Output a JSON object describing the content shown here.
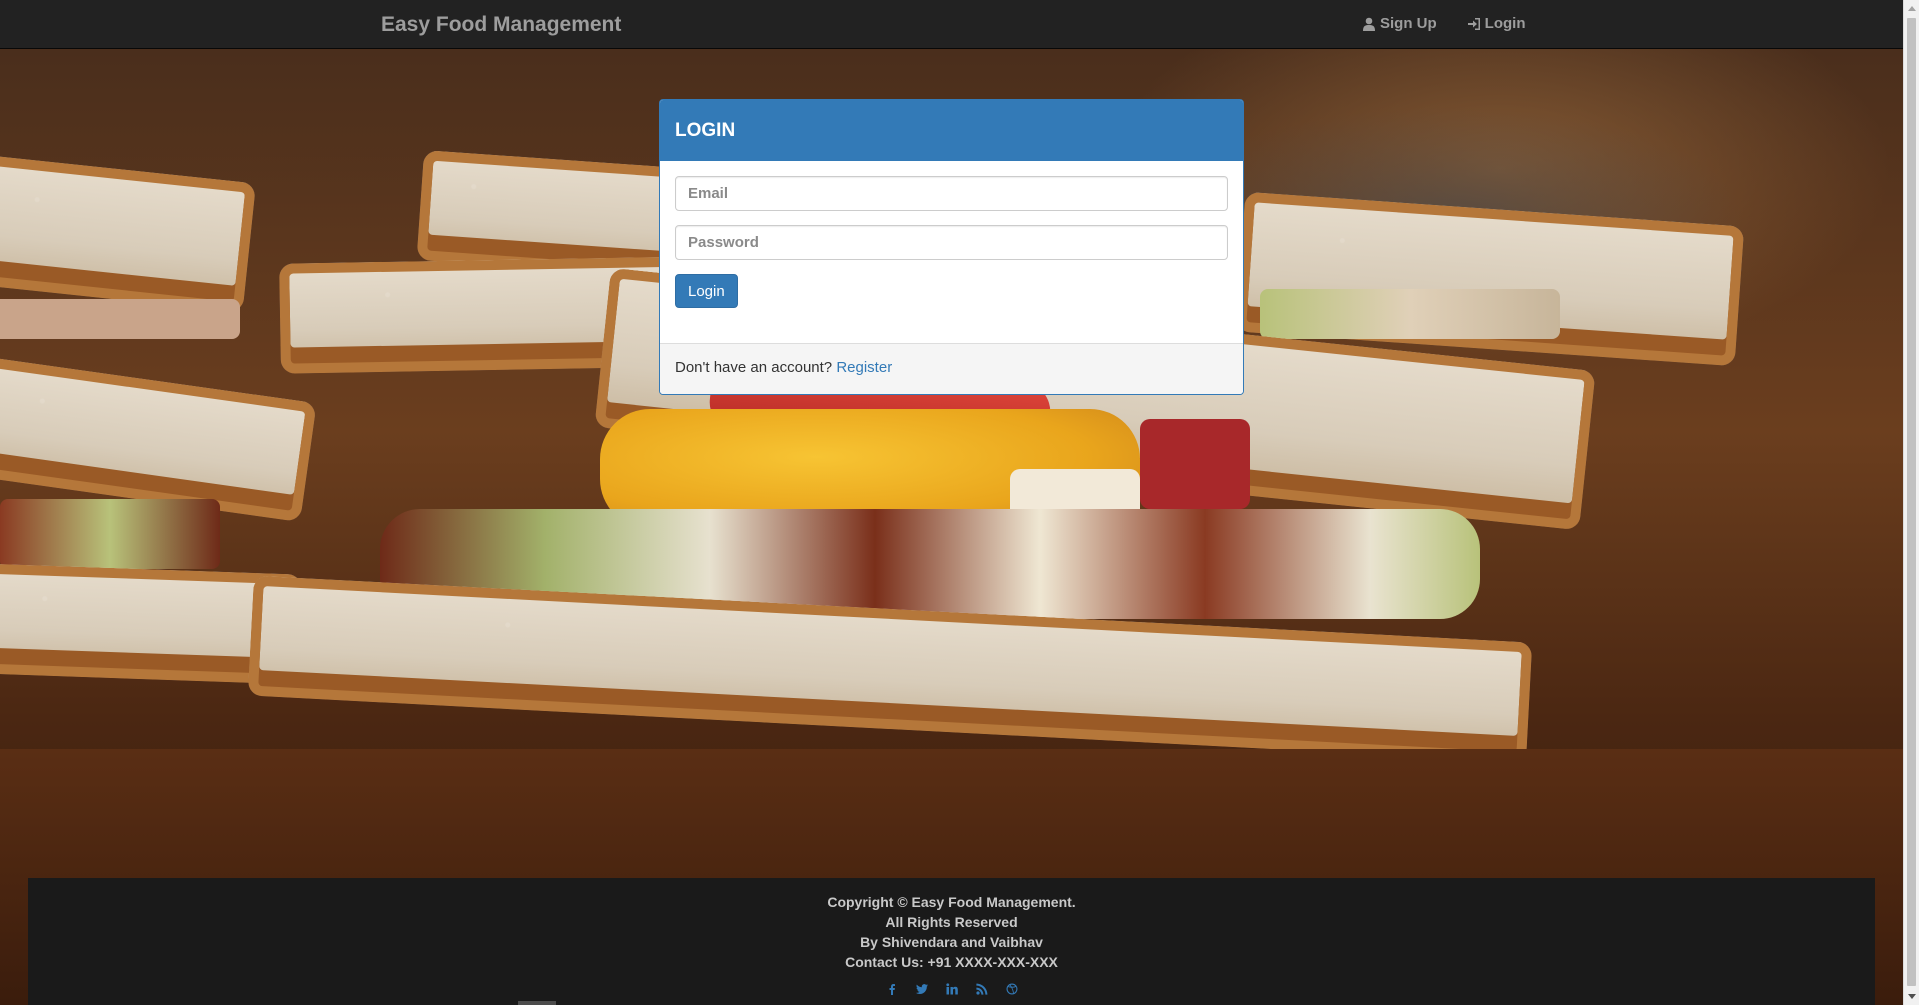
{
  "navbar": {
    "brand": "Easy Food Management",
    "signup_label": "Sign Up",
    "login_label": "Login"
  },
  "login_panel": {
    "title": "LOGIN",
    "email_placeholder": "Email",
    "password_placeholder": "Password",
    "submit_label": "Login",
    "footer_text": "Don't have an account?",
    "register_link": "Register"
  },
  "footer": {
    "copyright": "Copyright © Easy Food Management.",
    "rights": "All Rights Reserved",
    "authors": "By Shivendara and Vaibhav",
    "contact": "Contact Us: +91 XXXX-XXX-XXX",
    "social_icons": [
      "facebook-icon",
      "twitter-icon",
      "linkedin-icon",
      "rss-icon",
      "dribbble-icon"
    ]
  },
  "colors": {
    "navbar_bg": "#222222",
    "primary": "#337ab7",
    "footer_bg": "#1a1a1a"
  }
}
